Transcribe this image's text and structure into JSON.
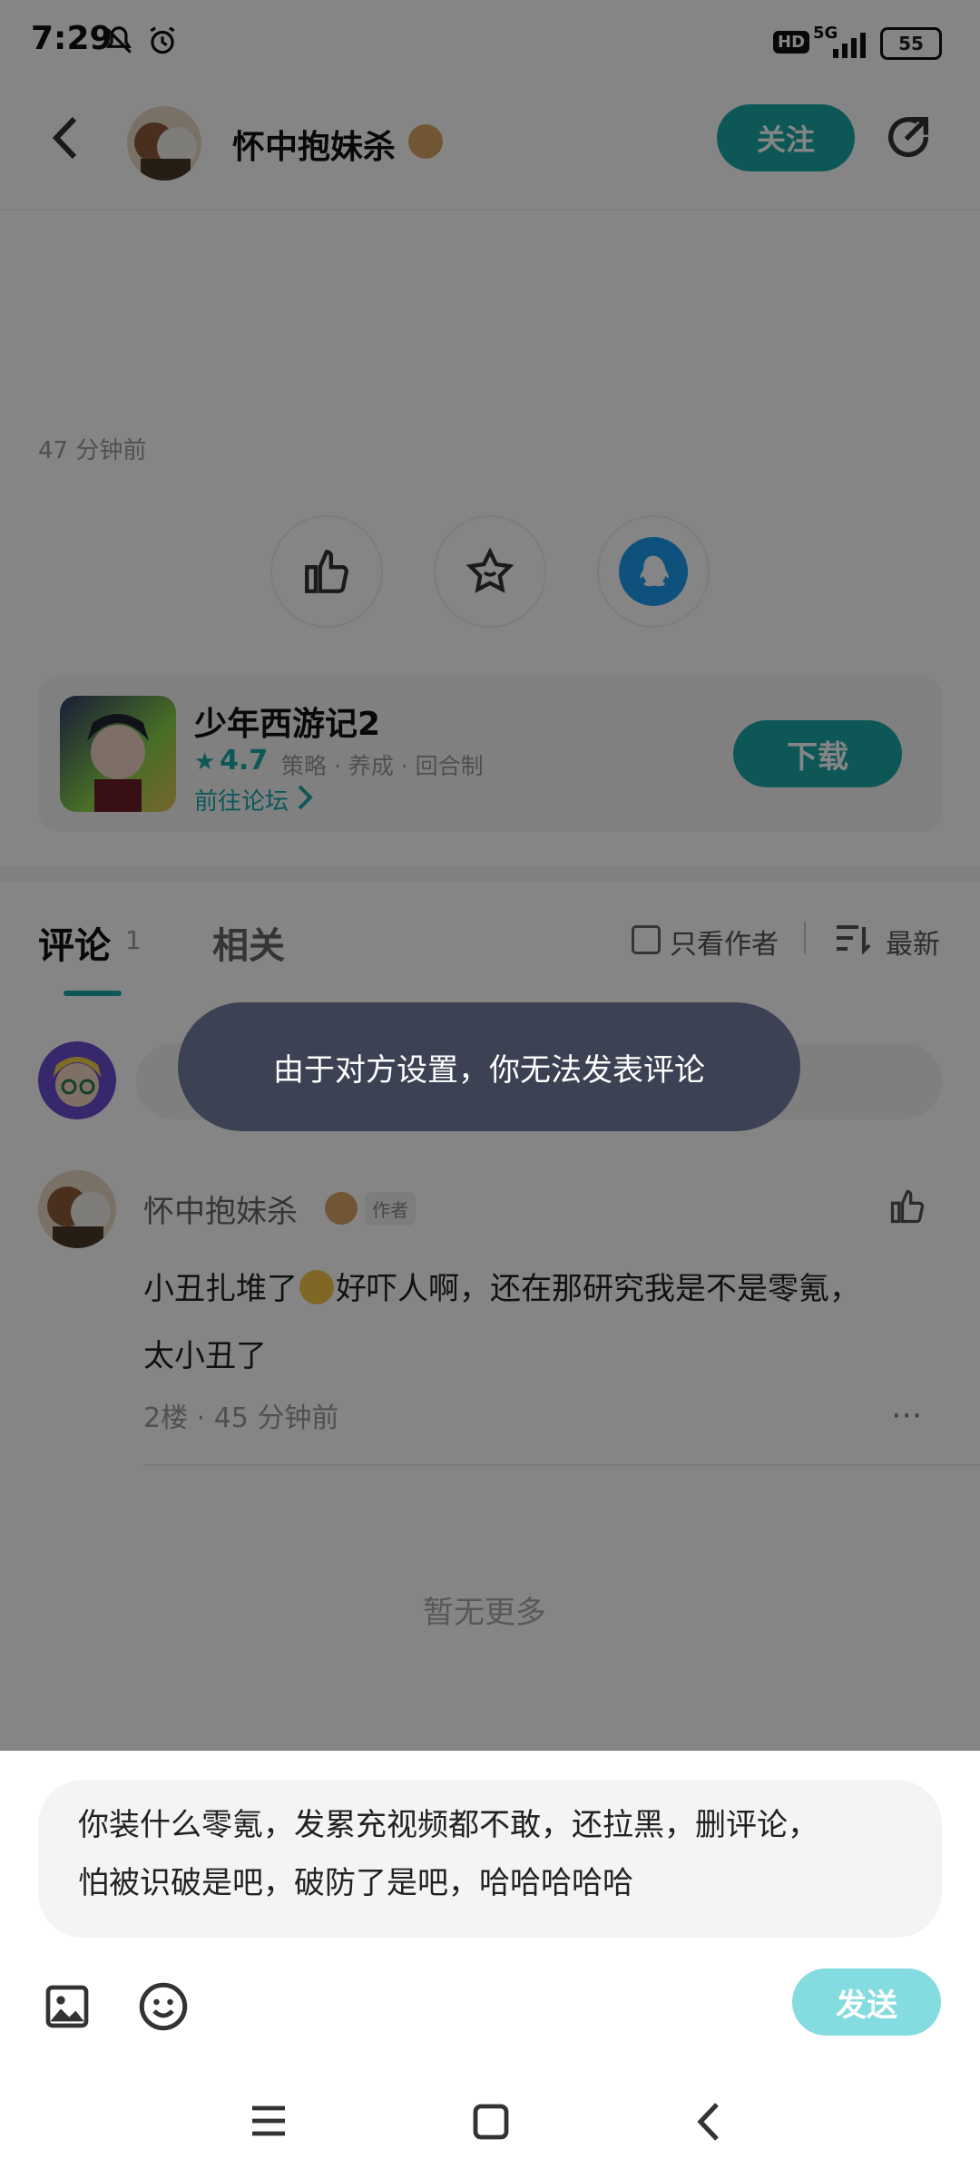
{
  "status": {
    "time": "7:29",
    "network": "5G",
    "hd": "HD",
    "battery": "55"
  },
  "header": {
    "username": "怀中抱妹杀",
    "follow_label": "关注"
  },
  "post": {
    "time": "47 分钟前"
  },
  "game": {
    "title": "少年西游记2",
    "rating": "4.7",
    "tags": "策略 · 养成 · 回合制",
    "forum_link": "前往论坛",
    "download_label": "下载"
  },
  "tabs": {
    "comments_label": "评论",
    "comments_count": "1",
    "related_label": "相关",
    "only_author_label": "只看作者",
    "sort_label": "最新"
  },
  "toast": {
    "message": "由于对方设置，你无法发表评论"
  },
  "comment": {
    "author": "怀中抱妹杀",
    "author_tag": "作者",
    "text_line1a": "小丑扎堆了",
    "text_line1b": "好吓人啊，还在那研究我是不是零氪，",
    "text_line2": "太小丑了",
    "meta": "2楼 · 45 分钟前"
  },
  "footer_note": "暂无更多",
  "composer": {
    "line1": "你装什么零氪，发累充视频都不敢，还拉黑，删评论，",
    "line2": "怕被识破是吧，破防了是吧，哈哈哈哈哈",
    "send_label": "发送"
  },
  "colors": {
    "accent": "#1aa9a7",
    "send_disabled": "#84dbe0",
    "toast_bg": "#3c4254"
  }
}
